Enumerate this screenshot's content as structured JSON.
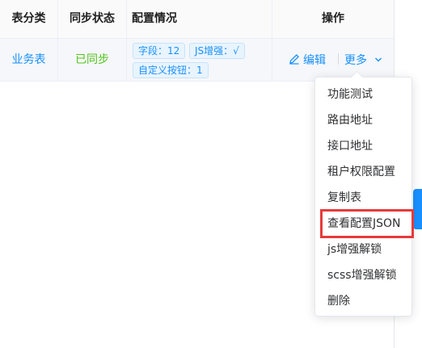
{
  "table": {
    "headers": {
      "category": "表分类",
      "sync_status": "同步状态",
      "config": "配置情况",
      "actions": "操作"
    },
    "row": {
      "category": "业务表",
      "sync_status": "已同步",
      "tags": [
        "字段：12",
        "JS增强：√",
        "自定义按钮：1"
      ],
      "edit_label": "编辑",
      "more_label": "更多"
    }
  },
  "dropdown": {
    "items": [
      "功能测试",
      "路由地址",
      "接口地址",
      "租户权限配置",
      "复制表",
      "查看配置JSON",
      "js增强解锁",
      "scss增强解锁",
      "删除"
    ],
    "highlighted_item": "查看配置JSON",
    "highlight_color": "#e83a3a"
  },
  "colors": {
    "accent": "#1890ff",
    "success": "#52c41a"
  }
}
